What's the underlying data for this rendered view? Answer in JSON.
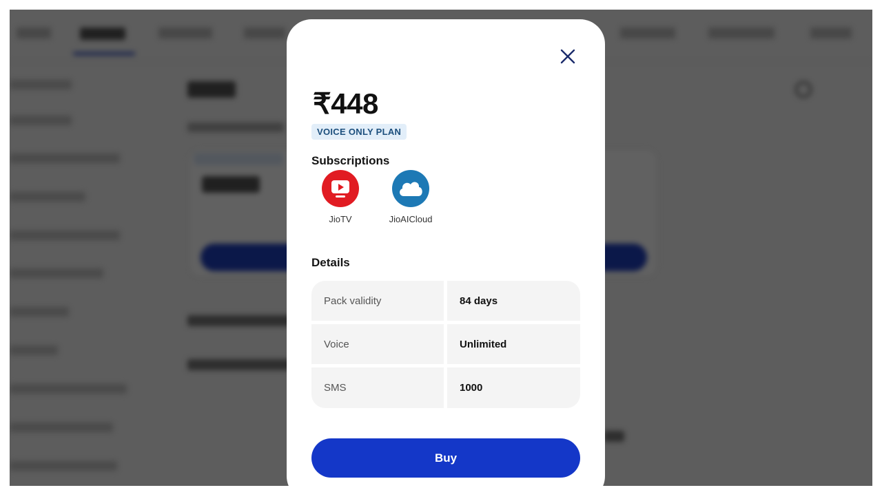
{
  "colors": {
    "accent": "#1437c8",
    "badge_bg": "#e2eef9",
    "badge_text": "#1c4f7d",
    "jiotv": "#e11b22",
    "jioaicloud": "#1d79b5",
    "overlay": "rgba(0,0,0,0.62)"
  },
  "modal": {
    "close_icon": "close-icon",
    "price": "₹448",
    "plan_badge": "VOICE ONLY PLAN",
    "subscriptions_heading": "Subscriptions",
    "subscriptions": [
      {
        "name": "JioTV",
        "icon": "jiotv-icon"
      },
      {
        "name": "JioAICloud",
        "icon": "jioaicloud-icon"
      }
    ],
    "details_heading": "Details",
    "details": [
      {
        "label": "Pack validity",
        "value": "84 days"
      },
      {
        "label": "Voice",
        "value": "Unlimited"
      },
      {
        "label": "SMS",
        "value": "1000"
      }
    ],
    "buy_label": "Buy"
  }
}
